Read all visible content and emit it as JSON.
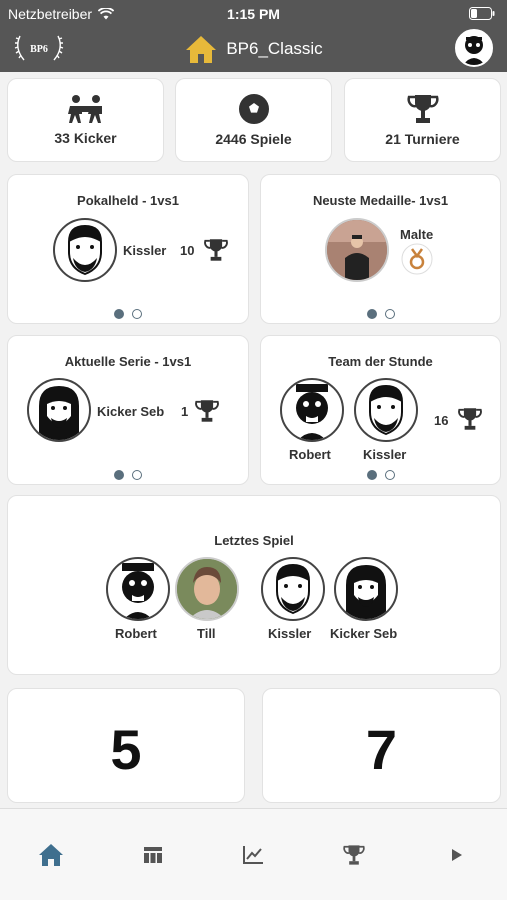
{
  "status": {
    "carrier": "Netzbetreiber",
    "time": "1:15 PM"
  },
  "nav": {
    "logo_text": "BP6",
    "title": "BP6_Classic",
    "icons": [
      "home-icon",
      "user-avatar"
    ]
  },
  "stats": [
    {
      "label": "33 Kicker",
      "icon": "players-icon"
    },
    {
      "label": "2446 Spiele",
      "icon": "soccer-ball-icon"
    },
    {
      "label": "21 Turniere",
      "icon": "trophy-icon"
    }
  ],
  "pokalheld": {
    "title": "Pokalheld - 1vs1",
    "player": "Kissler",
    "count": "10"
  },
  "neuste_medaille": {
    "title": "Neuste Medaille- 1vs1",
    "player": "Malte",
    "medal_color": "#c8823c"
  },
  "aktuelle_serie": {
    "title": "Aktuelle Serie - 1vs1",
    "player": "Kicker Seb",
    "count": "1"
  },
  "team_der_stunde": {
    "title": "Team der Stunde",
    "players": [
      "Robert",
      "Kissler"
    ],
    "count": "16"
  },
  "letztes_spiel": {
    "title": "Letztes Spiel",
    "team_a": [
      "Robert",
      "Till"
    ],
    "team_b": [
      "Kissler",
      "Kicker Seb"
    ],
    "score_a": "5",
    "score_b": "7"
  },
  "tabs": [
    {
      "icon": "home-icon",
      "active": true
    },
    {
      "icon": "table-icon",
      "active": false
    },
    {
      "icon": "chart-icon",
      "active": false
    },
    {
      "icon": "trophy-icon",
      "active": false
    },
    {
      "icon": "play-icon",
      "active": false
    }
  ],
  "colors": {
    "header": "#565656",
    "accent_active": "#3f6f8e",
    "home_icon": "#e7b93a"
  }
}
